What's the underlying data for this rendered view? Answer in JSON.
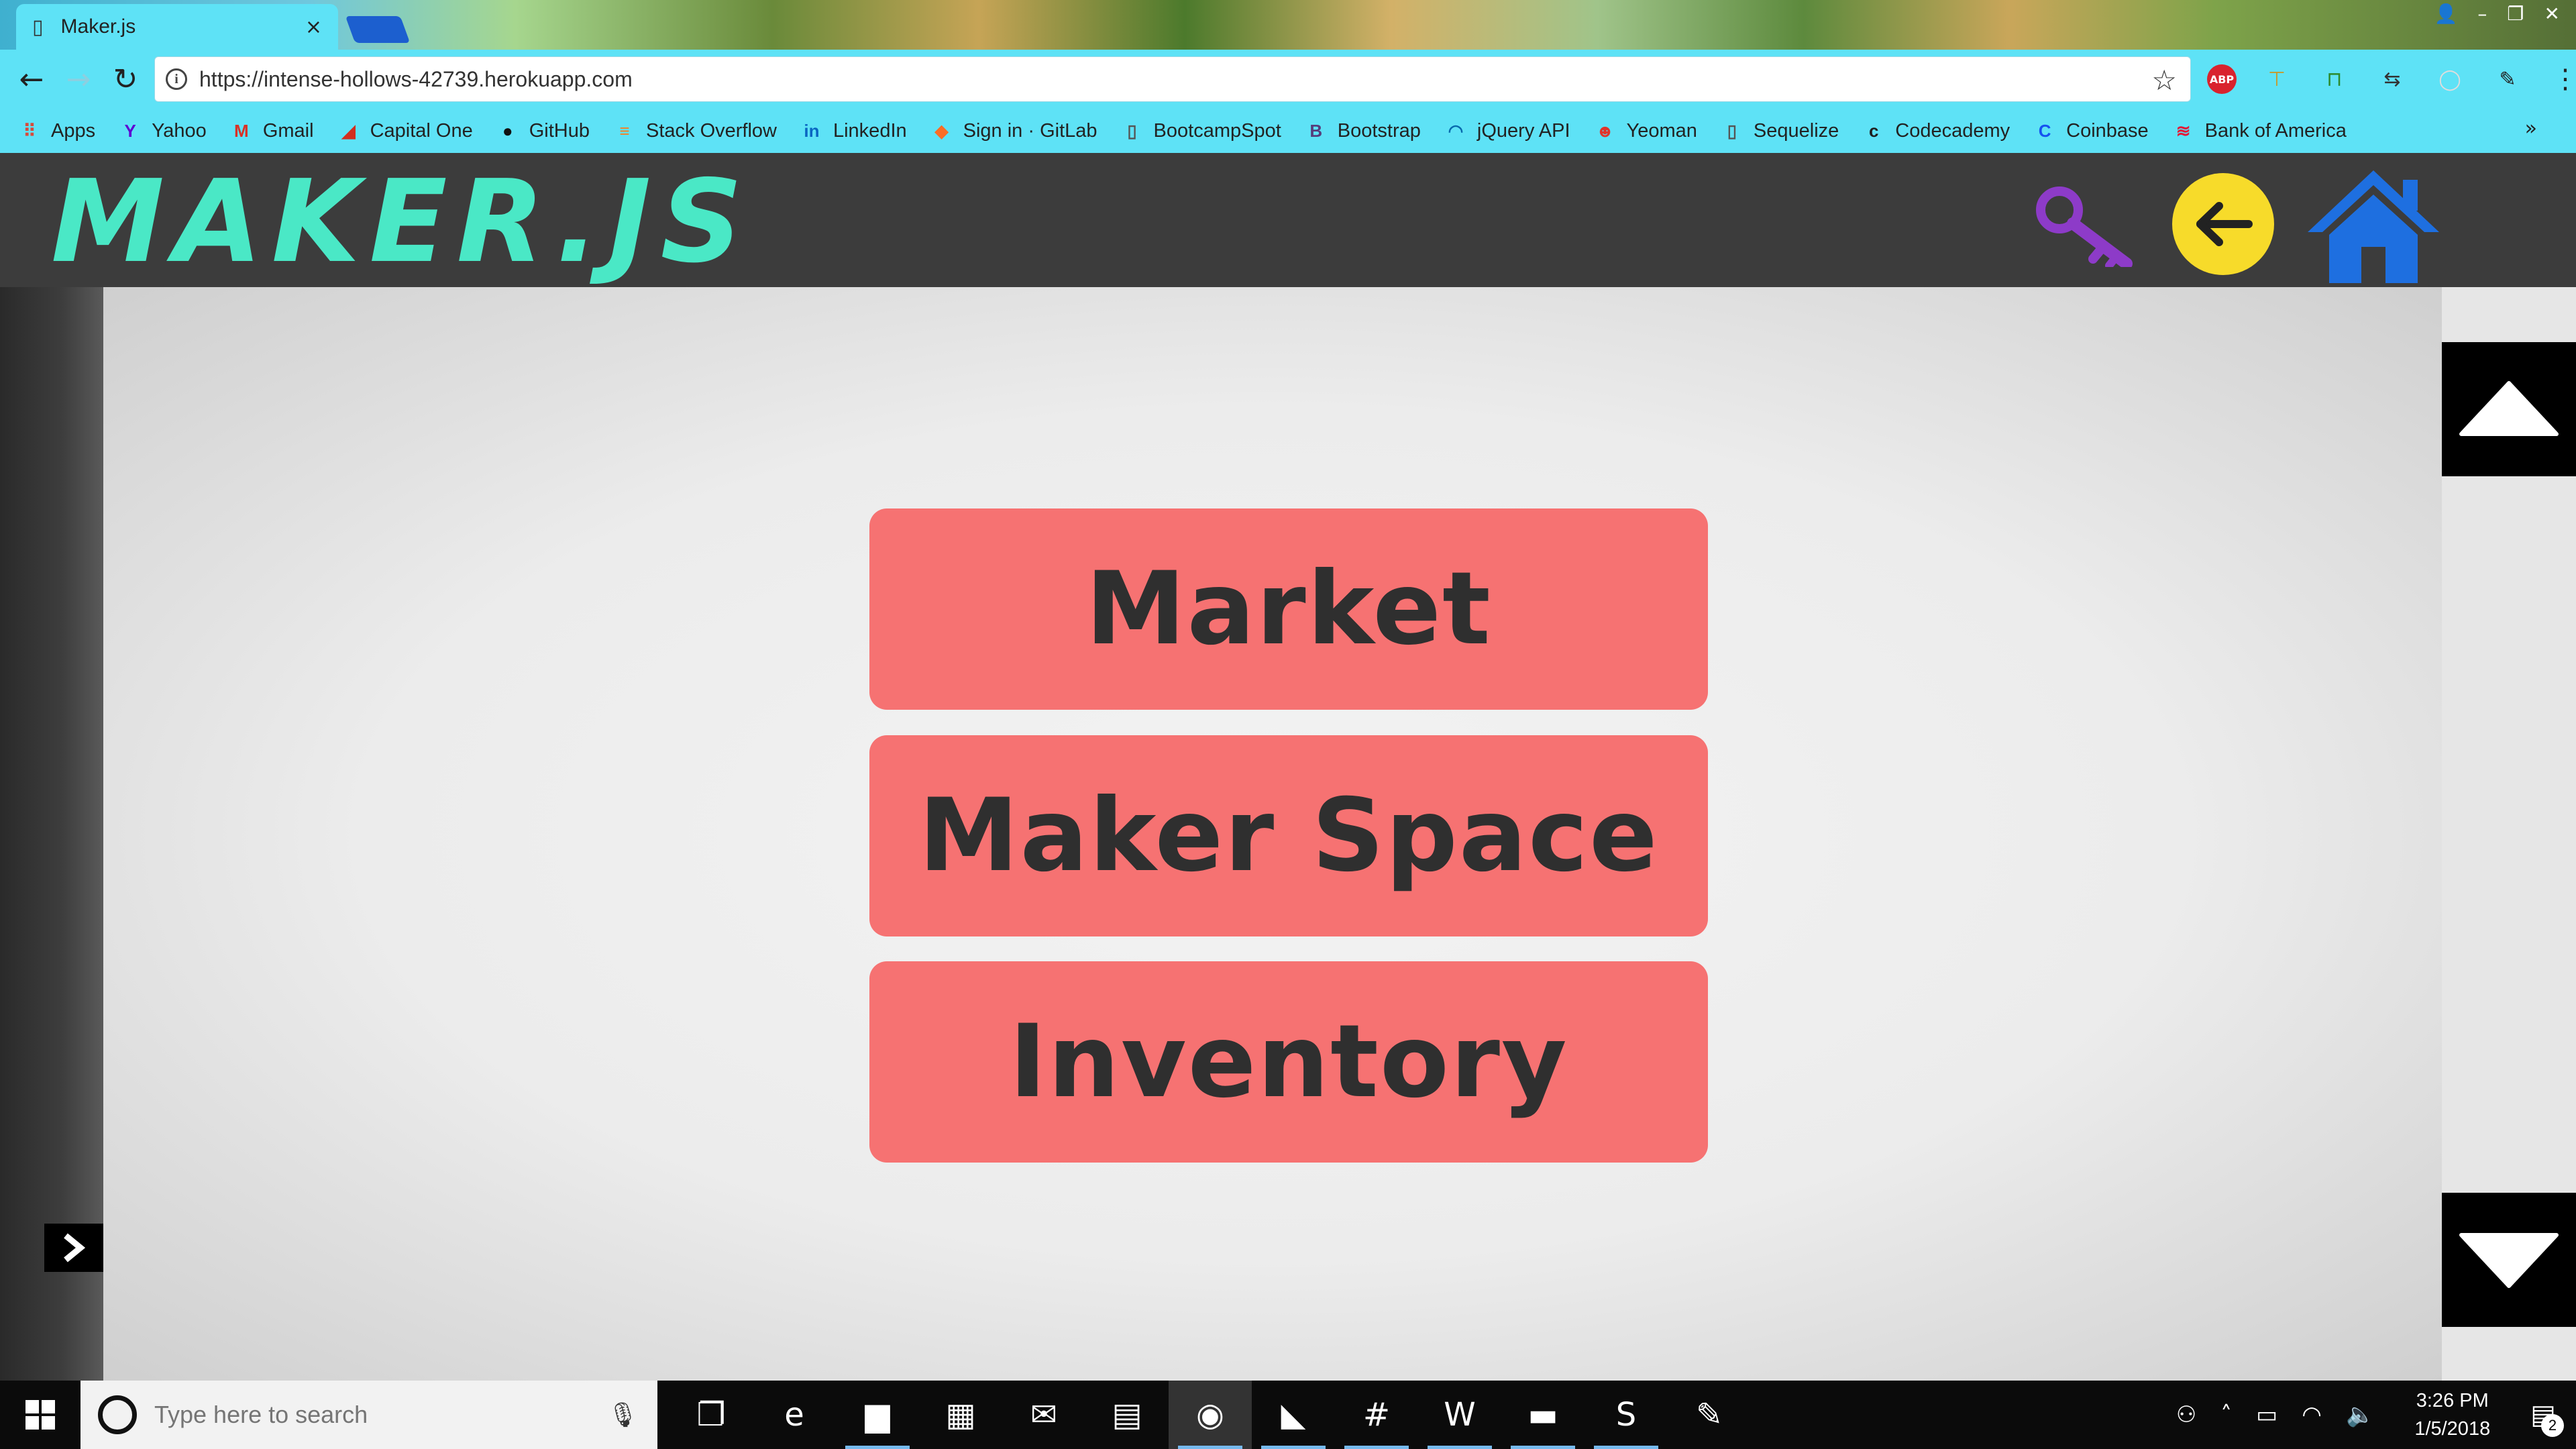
{
  "browser": {
    "tab": {
      "title": "Maker.js",
      "close_glyph": "×"
    },
    "url": "https://intense-hollows-42739.herokuapp.com",
    "extensions": [
      "adblock-plus-icon",
      "extension-icon",
      "new-badge-icon",
      "arrows-icon",
      "circle-icon",
      "eyedropper-icon"
    ],
    "extension_labels": {
      "adblock": "ABP"
    },
    "bookmarks": [
      {
        "label": "Apps",
        "icon": "apps-grid-icon",
        "glyph": "⠿",
        "color": "#d84a3a"
      },
      {
        "label": "Yahoo",
        "icon": "yahoo-icon",
        "glyph": "Y",
        "color": "#5f01d1"
      },
      {
        "label": "Gmail",
        "icon": "gmail-icon",
        "glyph": "M",
        "color": "#d93025"
      },
      {
        "label": "Capital One",
        "icon": "capital-one-icon",
        "glyph": "◢",
        "color": "#d22e1e"
      },
      {
        "label": "GitHub",
        "icon": "github-icon",
        "glyph": "●",
        "color": "#111111"
      },
      {
        "label": "Stack Overflow",
        "icon": "stackoverflow-icon",
        "glyph": "≡",
        "color": "#f48024"
      },
      {
        "label": "LinkedIn",
        "icon": "linkedin-icon",
        "glyph": "in",
        "color": "#0a66c2"
      },
      {
        "label": "Sign in · GitLab",
        "icon": "gitlab-icon",
        "glyph": "◆",
        "color": "#fc6d26"
      },
      {
        "label": "BootcampSpot",
        "icon": "page-icon",
        "glyph": "▯",
        "color": "#555555"
      },
      {
        "label": "Bootstrap",
        "icon": "bootstrap-icon",
        "glyph": "B",
        "color": "#563d7c"
      },
      {
        "label": "jQuery API",
        "icon": "jquery-icon",
        "glyph": "◠",
        "color": "#0769ad"
      },
      {
        "label": "Yeoman",
        "icon": "yeoman-icon",
        "glyph": "☻",
        "color": "#e0352b"
      },
      {
        "label": "Sequelize",
        "icon": "page-icon",
        "glyph": "▯",
        "color": "#555555"
      },
      {
        "label": "Codecademy",
        "icon": "codecademy-icon",
        "glyph": "c",
        "color": "#1f1f1f"
      },
      {
        "label": "Coinbase",
        "icon": "coinbase-icon",
        "glyph": "C",
        "color": "#1652f0"
      },
      {
        "label": "Bank of America",
        "icon": "bank-of-america-icon",
        "glyph": "≋",
        "color": "#e31837"
      }
    ],
    "bookmarks_overflow": "»"
  },
  "app": {
    "logo": "MAKER.JS",
    "header_icons": [
      "key-icon",
      "back-arrow-icon",
      "home-icon"
    ],
    "menu": {
      "market": "Market",
      "maker_space": "Maker Space",
      "inventory": "Inventory"
    }
  },
  "taskbar": {
    "search_placeholder": "Type here to search",
    "apps": [
      {
        "name": "task-view-icon",
        "glyph": "❐",
        "running": false
      },
      {
        "name": "edge-icon",
        "glyph": "e",
        "running": false
      },
      {
        "name": "file-explorer-icon",
        "glyph": "▆",
        "running": true
      },
      {
        "name": "store-icon",
        "glyph": "▦",
        "running": false
      },
      {
        "name": "mail-icon",
        "glyph": "✉",
        "running": false
      },
      {
        "name": "calculator-icon",
        "glyph": "▤",
        "running": false
      },
      {
        "name": "chrome-icon",
        "glyph": "◉",
        "running": true,
        "active": true
      },
      {
        "name": "mysql-workbench-icon",
        "glyph": "◣",
        "running": true
      },
      {
        "name": "slack-icon",
        "glyph": "#",
        "running": true
      },
      {
        "name": "word-icon",
        "glyph": "W",
        "running": true
      },
      {
        "name": "terminal-icon",
        "glyph": "▬",
        "running": true
      },
      {
        "name": "sublime-text-icon",
        "glyph": "S",
        "running": true
      },
      {
        "name": "paint-icon",
        "glyph": "✎",
        "running": false
      }
    ],
    "time": "3:26 PM",
    "date": "1/5/2018",
    "notifications": "2"
  },
  "colors": {
    "chrome_accent": "#5ee2f6",
    "header_bg": "#3c3c3c",
    "logo": "#4ae8c6",
    "menu_button": "#f67272",
    "key_icon": "#8d3bc8",
    "back_button": "#f7db2a",
    "home_icon": "#1e6fe0"
  }
}
